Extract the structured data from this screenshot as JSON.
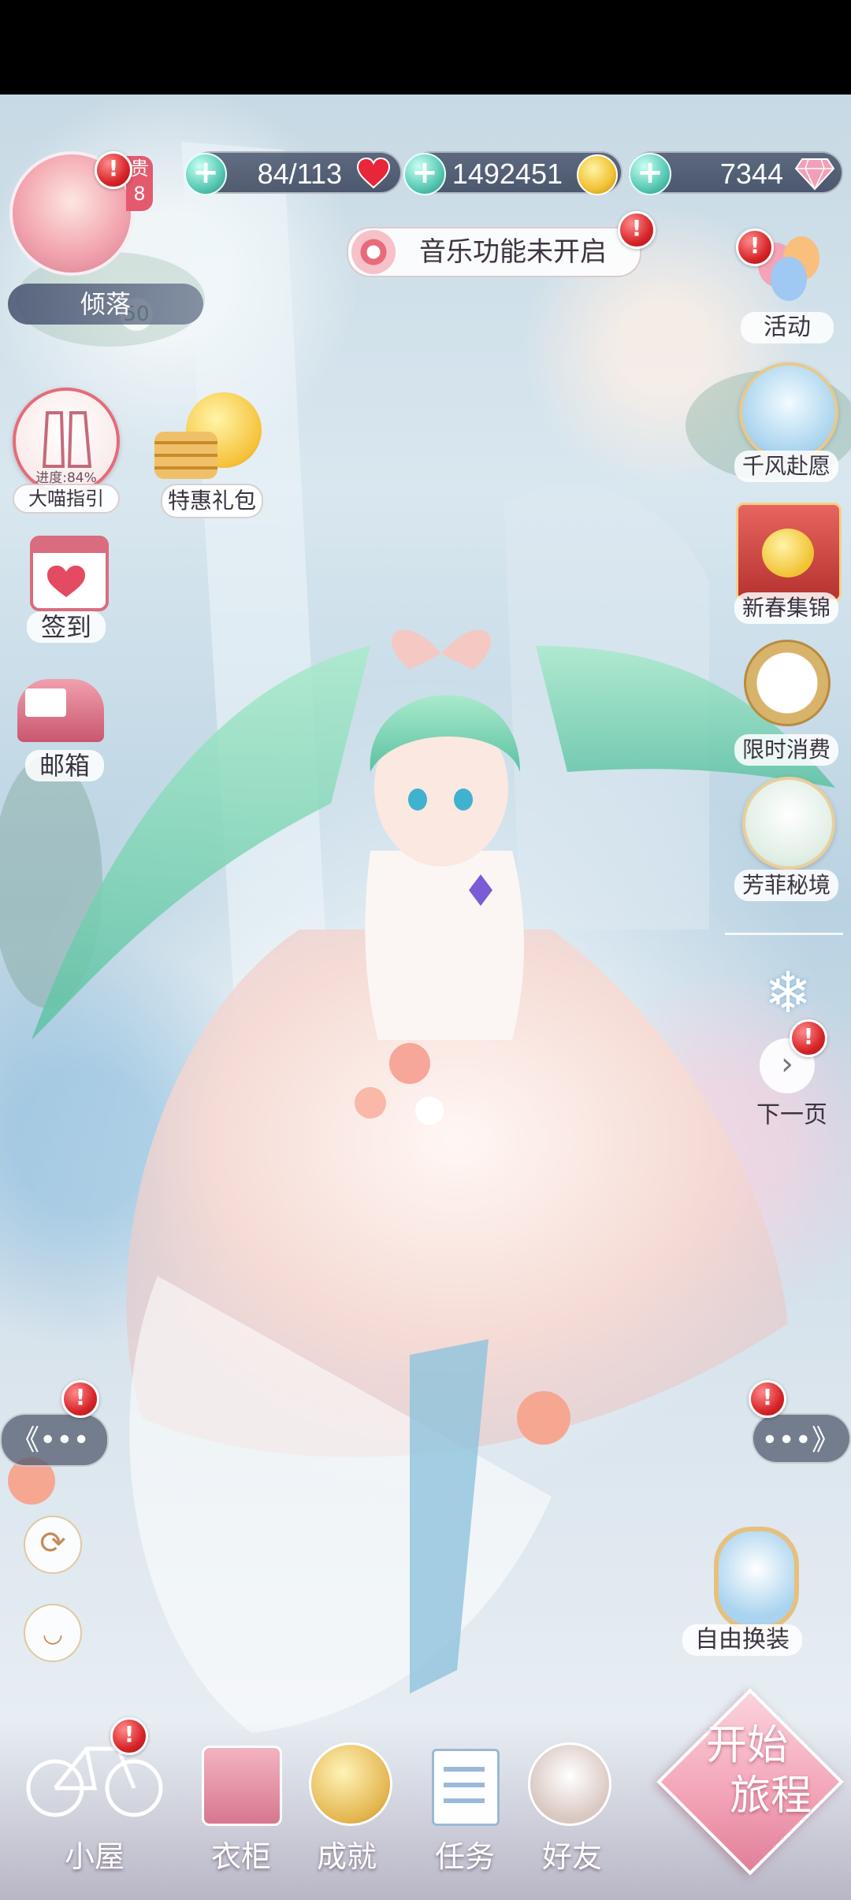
{
  "resources": {
    "stamina": "84/113",
    "coins": "1492451",
    "diamonds": "7344"
  },
  "player": {
    "name": "倾落",
    "vip_partial": "贵",
    "level_partial": "8",
    "exp_partial": "50"
  },
  "music_notice": "音乐功能未开启",
  "left_menu": {
    "guide_label": "大喵指引",
    "guide_progress": "进度:84%",
    "gift_pack": "特惠礼包",
    "sign_in": "签到",
    "mailbox": "邮箱"
  },
  "right_menu": {
    "activity": "活动",
    "wish": "千风赴愿",
    "spring": "新春集锦",
    "limited": "限时消费",
    "secret": "芳菲秘境",
    "next_page": "下一页",
    "free_dress": "自由换装"
  },
  "bottom_nav": {
    "cottage": "小屋",
    "wardrobe": "衣柜",
    "achievement": "成就",
    "tasks": "任务",
    "friends": "好友",
    "start_line1": "开始",
    "start_line2": "旅程"
  },
  "alert_symbol": "!",
  "arrows": {
    "left": "《•••",
    "right": "•••》"
  },
  "colors": {
    "alert_red": "#d7262a",
    "pill_bg": "#3c4862",
    "accent_teal": "#58c9b4",
    "start_pink": "#f2a2b5"
  }
}
